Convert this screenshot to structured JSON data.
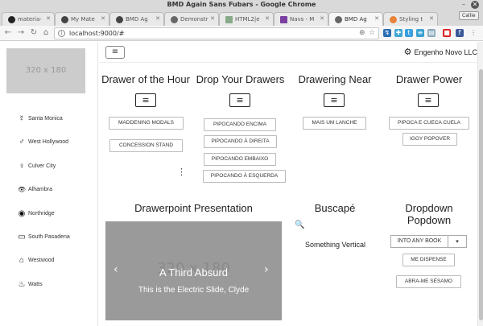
{
  "window": {
    "title": "BMD Again Sans Fubars - Google Chrome",
    "user_chip": "Callie",
    "minimize": "–",
    "close": "✕"
  },
  "tabs": [
    {
      "label": "materia-",
      "icon": "github-icon"
    },
    {
      "label": "My Mate",
      "icon": "radiation-icon"
    },
    {
      "label": "BMD Ag",
      "icon": "radiation-icon"
    },
    {
      "label": "Demonstr",
      "icon": "gear-icon"
    },
    {
      "label": "HTML2|e",
      "icon": "page-icon"
    },
    {
      "label": "Navs - M",
      "icon": "purple-square-icon"
    },
    {
      "label": "BMD Ag",
      "icon": "gear-icon",
      "active": true
    },
    {
      "label": "Styling t",
      "icon": "orange-icon"
    }
  ],
  "toolbar": {
    "url": "localhost:9000/#",
    "back": "←",
    "forward": "→",
    "reload": "↻",
    "home": "⌂",
    "info": "i"
  },
  "sidebar": {
    "placeholder": "320 x 180",
    "items": [
      {
        "label": "Santa Monica",
        "icon": "venus-mars-icon",
        "glyph": "☿"
      },
      {
        "label": "West Hollywood",
        "icon": "mars-icon",
        "glyph": "♂"
      },
      {
        "label": "Culver City",
        "icon": "venus-icon",
        "glyph": "♀"
      },
      {
        "label": "Alhambra",
        "icon": "eye-icon",
        "glyph": "👁"
      },
      {
        "label": "Northridge",
        "icon": "rss-icon",
        "glyph": "◉"
      },
      {
        "label": "South Pasadena",
        "icon": "desktop-icon",
        "glyph": "▭"
      },
      {
        "label": "Westwood",
        "icon": "bank-icon",
        "glyph": "⌂"
      },
      {
        "label": "Watts",
        "icon": "fire-icon",
        "glyph": "♨"
      }
    ]
  },
  "topnav": {
    "menu": "≡",
    "brand": "Engenho Novo LLC",
    "gear": "⚙"
  },
  "sections": {
    "drawer_hour": {
      "title": "Drawer of the Hour",
      "menu": "≡",
      "buttons": [
        "MADDENING MODALS",
        "CONCESSION STAND"
      ],
      "kebab": "⋮"
    },
    "drop_drawers": {
      "title": "Drop Your Drawers",
      "menu": "≡",
      "buttons": [
        "PIPOCANDO ENCIMA",
        "PIPOCANDO À DIREITA",
        "PIPOCANDO EMBAIXO",
        "PIPOCANDO À ESQUERDA"
      ]
    },
    "drawering_near": {
      "title": "Drawering Near",
      "menu": "≡",
      "buttons": [
        "MAIS UM LANCHE"
      ]
    },
    "drawer_power": {
      "title": "Drawer Power",
      "menu": "≡",
      "buttons": [
        "PIPOCA E CUECA CUELA",
        "IGGY POPOVER"
      ]
    },
    "drawerpoint": {
      "title": "Drawerpoint Presentation",
      "placeholder": "320 x 180",
      "caption": "A Third Absurd",
      "subcaption": "This is the Electric Slide, Clyde",
      "prev": "‹",
      "next": "›"
    },
    "buscape": {
      "title": "Buscapé",
      "search": "🔍",
      "text": "Something Vertical"
    },
    "dropdown": {
      "title_line1": "Dropdown",
      "title_line2": "Popdown",
      "split_label": "INTO ANY BOOK",
      "caret": "▾",
      "buttons": [
        "ME DISPENSE",
        "ABRA-ME SÉSAMO"
      ]
    }
  }
}
